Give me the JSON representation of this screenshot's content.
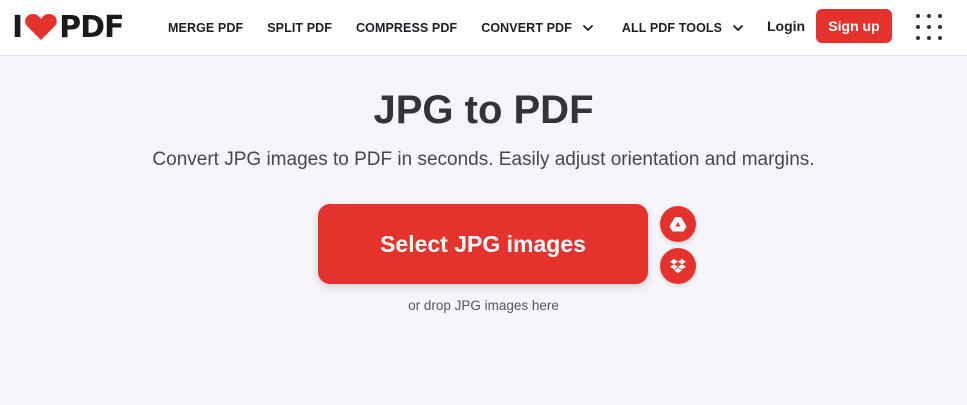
{
  "brand": {
    "left": "I",
    "right": "PDF",
    "accent": "#e5322d"
  },
  "nav": {
    "items": [
      {
        "label": "MERGE PDF",
        "dropdown": false
      },
      {
        "label": "SPLIT PDF",
        "dropdown": false
      },
      {
        "label": "COMPRESS PDF",
        "dropdown": false
      },
      {
        "label": "CONVERT PDF",
        "dropdown": true
      },
      {
        "label": "ALL PDF TOOLS",
        "dropdown": true
      }
    ]
  },
  "auth": {
    "login": "Login",
    "signup": "Sign up"
  },
  "main": {
    "title": "JPG to PDF",
    "subtitle": "Convert JPG images to PDF in seconds. Easily adjust orientation and margins.",
    "select_label": "Select JPG images",
    "drop_hint": "or drop JPG images here"
  },
  "icons": {
    "heart": "heart-logo-icon",
    "chevron": "chevron-down-icon",
    "apps": "apps-grid-icon",
    "drive": "google-drive-icon",
    "dropbox": "dropbox-icon"
  },
  "colors": {
    "primary": "#e5322d",
    "background": "#f5f5fa",
    "text": "#33333b"
  }
}
